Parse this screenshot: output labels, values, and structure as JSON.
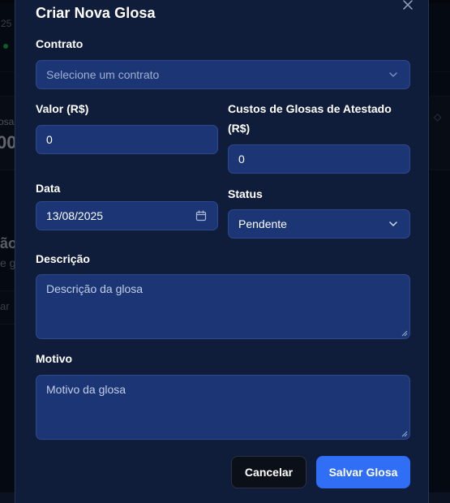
{
  "background": {
    "left_fragments": [
      "25",
      "osa",
      "00",
      "ão",
      "e g",
      "ar"
    ]
  },
  "modal": {
    "title": "Criar Nova Glosa",
    "close_icon": "close-icon",
    "fields": {
      "contrato": {
        "label": "Contrato",
        "placeholder": "Selecione um contrato"
      },
      "valor": {
        "label": "Valor (R$)",
        "value": "0"
      },
      "custos": {
        "label_line1": "Custos de Glosas de Atestado",
        "label_line2": "(R$)",
        "value": "0"
      },
      "data": {
        "label": "Data",
        "value": "13/08/2025",
        "icon": "calendar-icon"
      },
      "status": {
        "label": "Status",
        "value": "Pendente",
        "icon": "chevron-down-icon"
      },
      "descricao": {
        "label": "Descrição",
        "placeholder": "Descrição da glosa"
      },
      "motivo": {
        "label": "Motivo",
        "placeholder": "Motivo da glosa"
      }
    },
    "buttons": {
      "cancel": "Cancelar",
      "save": "Salvar Glosa"
    }
  },
  "colors": {
    "modal_bg": "#0f1d3b",
    "input_bg": "#1b3575",
    "primary": "#2f6ef5",
    "cancel_bg": "#0b0f17"
  }
}
